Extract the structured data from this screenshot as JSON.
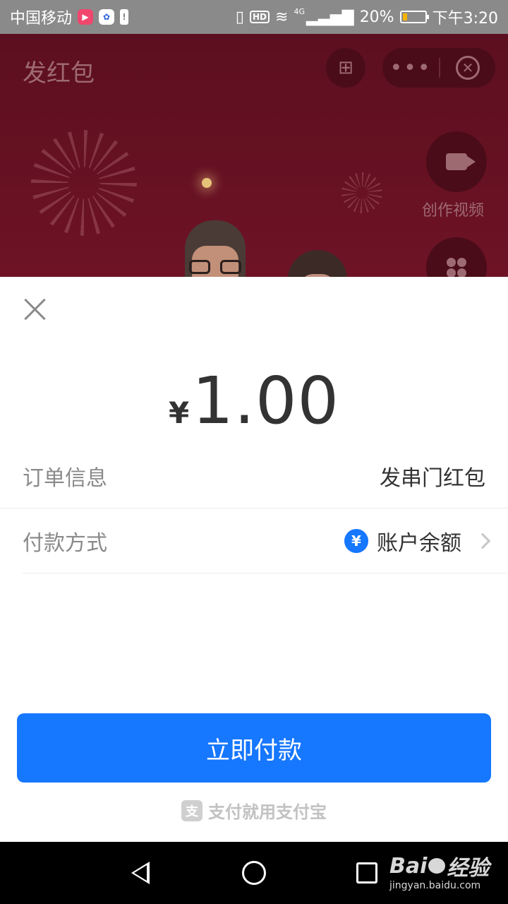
{
  "status_bar": {
    "carrier": "中国移动",
    "network": "4G",
    "battery": "20%",
    "battery_level": 0.2,
    "time": "下午3:20",
    "hd": "HD"
  },
  "background_app": {
    "title": "发红包",
    "video_label": "创作视频"
  },
  "payment_sheet": {
    "currency_symbol": "¥",
    "amount": "1.00",
    "order_label": "订单信息",
    "order_value": "发串门红包",
    "method_label": "付款方式",
    "method_icon": "¥",
    "method_value": "账户余额",
    "pay_button": "立即付款",
    "footer_logo": "支",
    "footer_text": "支付就用支付宝"
  },
  "nav_bar": {
    "watermark_brand_left": "Bai",
    "watermark_brand_right": "经验",
    "watermark_url": "jingyan.baidu.com"
  },
  "colors": {
    "primary": "#1677ff",
    "status_bar_bg": "#8a8a8a",
    "background_app": "#6e1326"
  }
}
